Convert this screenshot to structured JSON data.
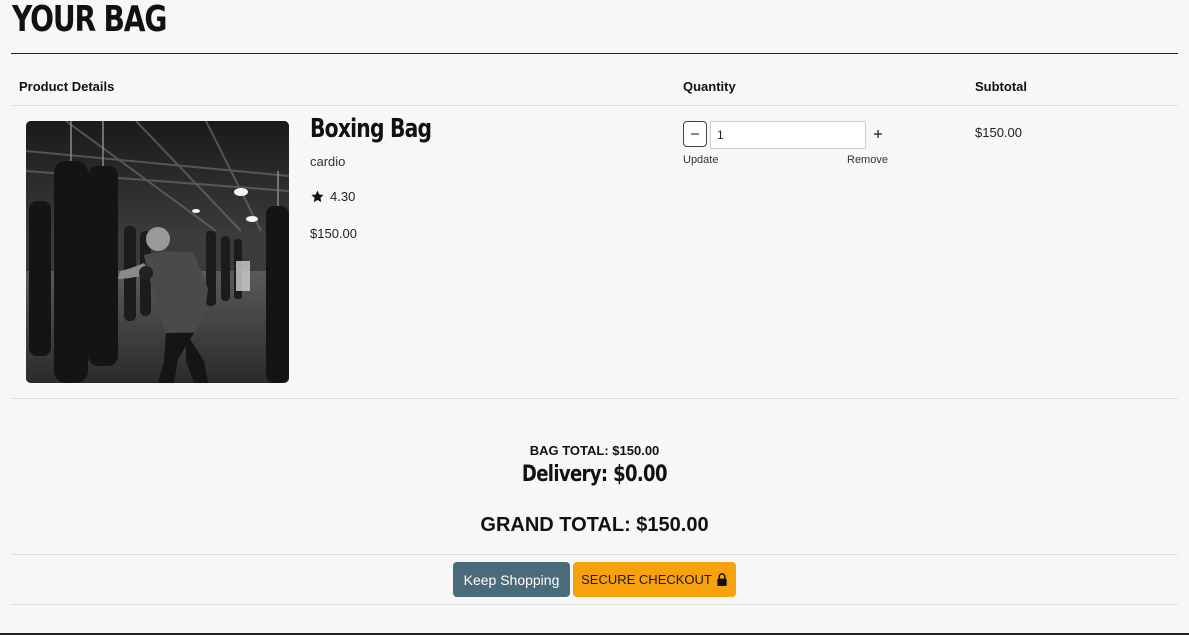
{
  "page": {
    "title": "YOUR BAG"
  },
  "table": {
    "headers": {
      "product": "Product Details",
      "quantity": "Quantity",
      "subtotal": "Subtotal"
    }
  },
  "item": {
    "name": "Boxing Bag",
    "category": "cardio",
    "rating": "4.30",
    "price": "$150.00",
    "quantity": "1",
    "update_label": "Update",
    "remove_label": "Remove",
    "subtotal": "$150.00",
    "image_icon": "boxing-gym-photo"
  },
  "totals": {
    "bag_total": "BAG TOTAL: $150.00",
    "delivery": "Delivery: $0.00",
    "grand_total": "GRAND TOTAL: $150.00"
  },
  "actions": {
    "keep_shopping": "Keep Shopping",
    "checkout": "SECURE CHECKOUT"
  },
  "colors": {
    "background": "#f7f8f5",
    "keep_shopping": "#4b6b7a",
    "checkout": "#f7a20d"
  }
}
